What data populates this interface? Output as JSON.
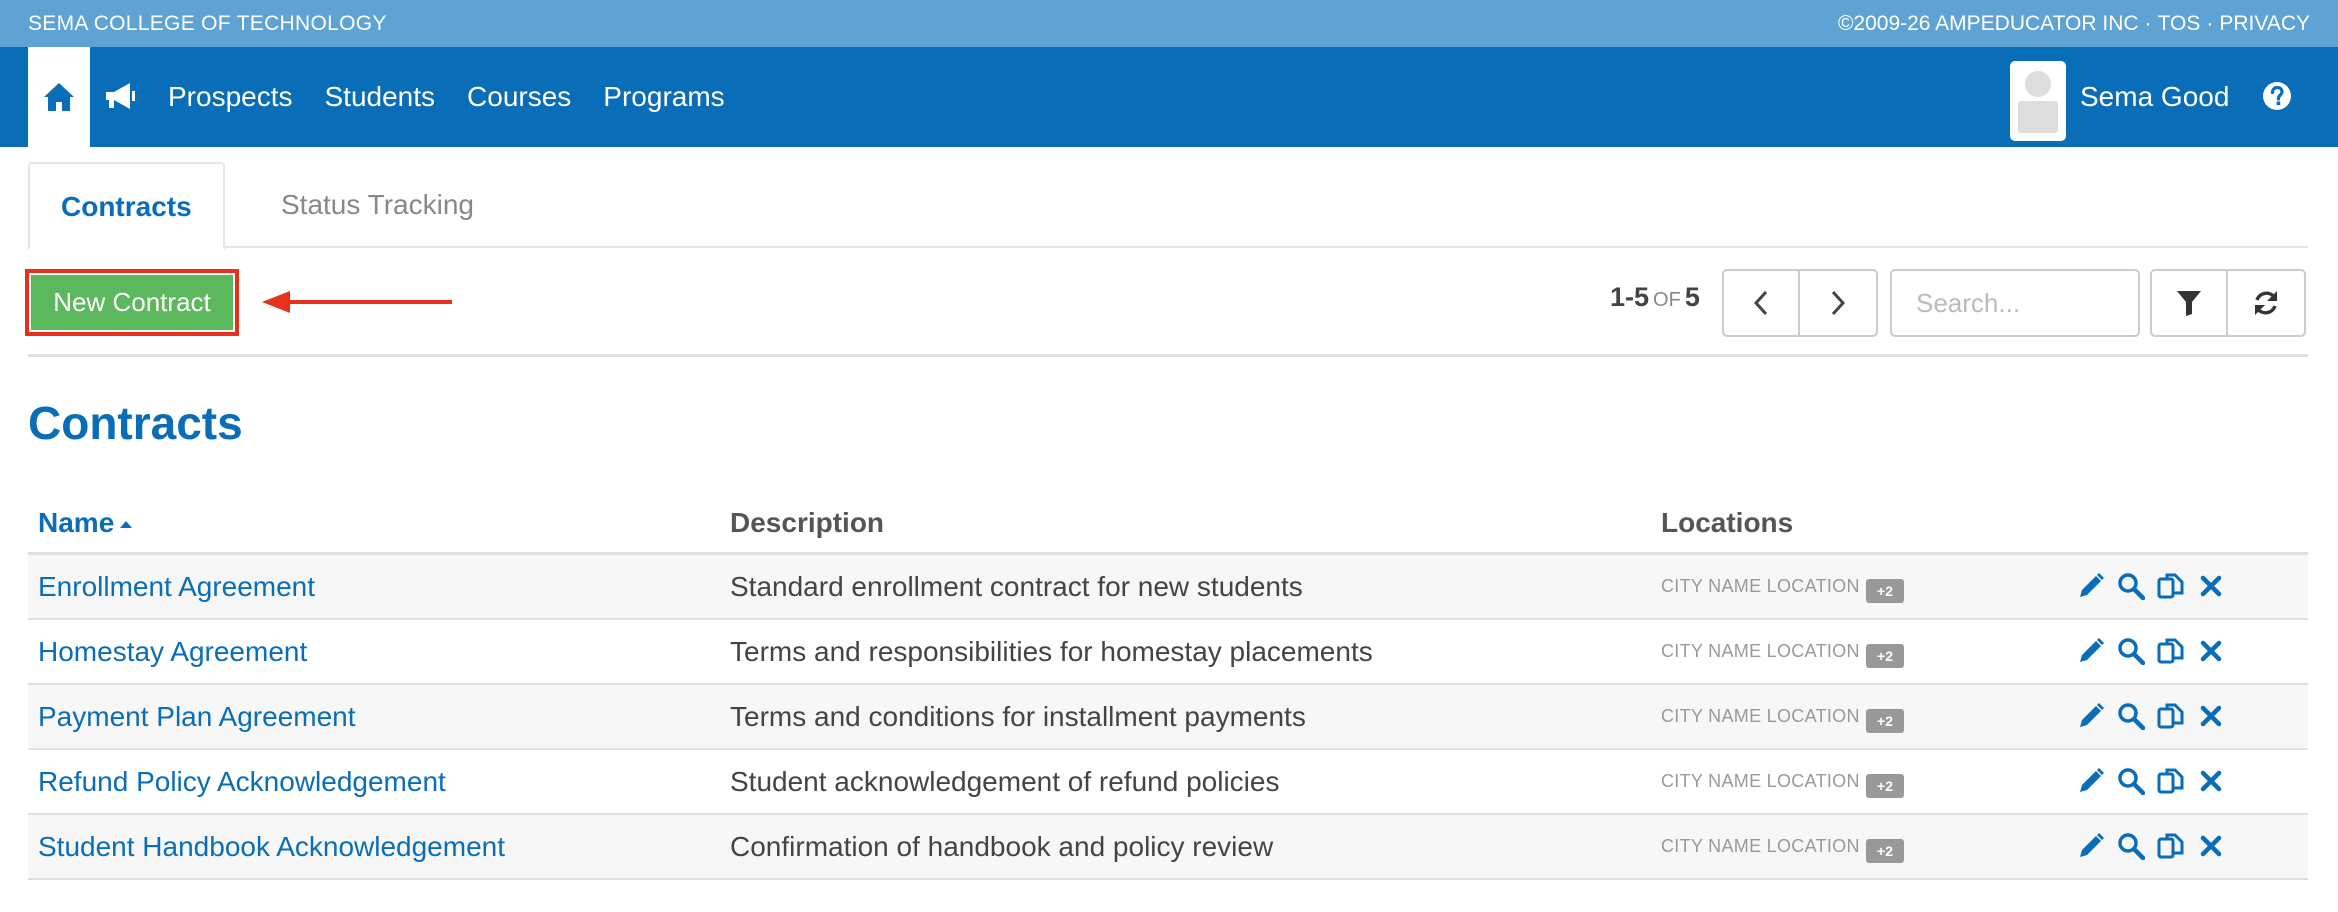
{
  "topstrip": {
    "org": "SEMA COLLEGE OF TECHNOLOGY",
    "copyright": "©2009-26 AMPEDUCATOR INC",
    "tos": "TOS",
    "privacy": "PRIVACY",
    "separator": "·"
  },
  "nav": {
    "links": [
      "Prospects",
      "Students",
      "Courses",
      "Programs"
    ],
    "user_name": "Sema Good"
  },
  "tabs": [
    "Contracts",
    "Status Tracking"
  ],
  "toolbar": {
    "new_label": "New Contract",
    "range": "1-5",
    "of": "OF",
    "total": "5",
    "search_placeholder": "Search..."
  },
  "section_title": "Contracts",
  "table": {
    "headers": [
      "Name",
      "Description",
      "Locations"
    ],
    "rows": [
      {
        "name": "Enrollment Agreement",
        "description": "Standard enrollment contract for new students",
        "location": "CITY NAME LOCATION",
        "badge": "+2"
      },
      {
        "name": "Homestay Agreement",
        "description": "Terms and responsibilities for homestay placements",
        "location": "CITY NAME LOCATION",
        "badge": "+2"
      },
      {
        "name": "Payment Plan Agreement",
        "description": "Terms and conditions for installment payments",
        "location": "CITY NAME LOCATION",
        "badge": "+2"
      },
      {
        "name": "Refund Policy Acknowledgement",
        "description": "Student acknowledgement of refund policies",
        "location": "CITY NAME LOCATION",
        "badge": "+2"
      },
      {
        "name": "Student Handbook Acknowledgement",
        "description": "Confirmation of handbook and policy review",
        "location": "CITY NAME LOCATION",
        "badge": "+2"
      }
    ]
  },
  "colors": {
    "brand_blue": "#0a6db7",
    "strip_blue": "#5ea3d4",
    "new_button_green": "#5cb85c",
    "highlight_red": "#e8311a"
  }
}
